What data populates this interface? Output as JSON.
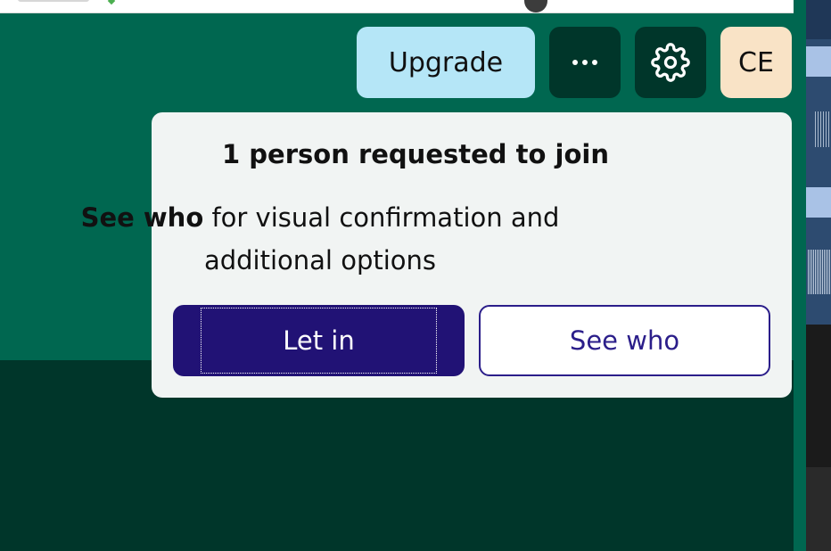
{
  "toolbar": {
    "upgrade_label": "Upgrade",
    "more_icon": "more-horizontal-icon",
    "settings_icon": "gear-icon",
    "avatar_initials": "CE"
  },
  "join_request": {
    "title": "1 person requested to join",
    "body_bold": "See who",
    "body_rest": " for visual confirmation and additional options",
    "let_in_label": "Let in",
    "see_who_label": "See who"
  },
  "colors": {
    "app_bg": "#006750",
    "app_bg_dark": "#00362a",
    "upgrade_bg": "#b5e6f7",
    "avatar_bg": "#f9e3c6",
    "popup_bg": "#f1f4f3",
    "primary": "#211275"
  }
}
